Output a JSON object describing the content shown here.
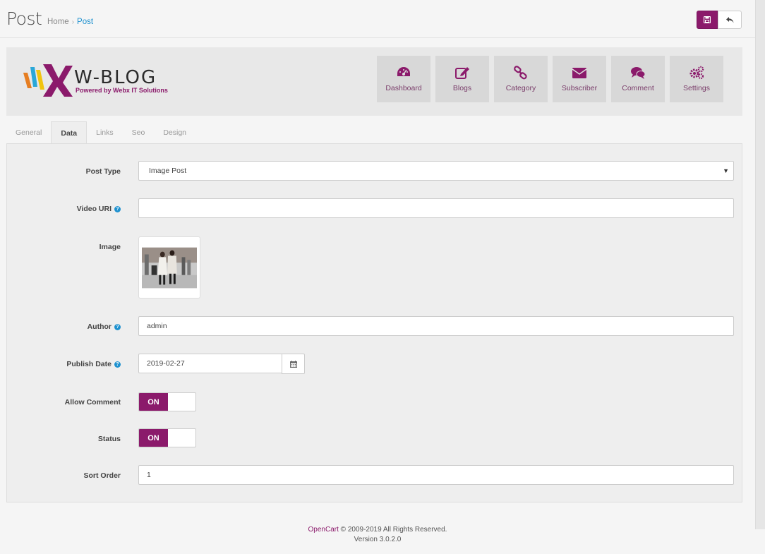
{
  "header": {
    "title": "Post",
    "breadcrumb": [
      "Home",
      "Post"
    ],
    "breadcrumb_sep": "›"
  },
  "logo": {
    "name": "W-BLOG",
    "tagline": "Powered by Webx IT Solutions"
  },
  "nav_tiles": [
    {
      "label": "Dashboard",
      "icon": "dashboard-icon"
    },
    {
      "label": "Blogs",
      "icon": "edit-icon"
    },
    {
      "label": "Category",
      "icon": "link-icon"
    },
    {
      "label": "Subscriber",
      "icon": "envelope-icon"
    },
    {
      "label": "Comment",
      "icon": "comments-icon"
    },
    {
      "label": "Settings",
      "icon": "cogs-icon"
    }
  ],
  "tabs": [
    {
      "label": "General",
      "active": false
    },
    {
      "label": "Data",
      "active": true
    },
    {
      "label": "Links",
      "active": false
    },
    {
      "label": "Seo",
      "active": false
    },
    {
      "label": "Design",
      "active": false
    }
  ],
  "form": {
    "post_type": {
      "label": "Post Type",
      "value": "Image Post"
    },
    "video_uri": {
      "label": "Video URI",
      "value": ""
    },
    "image": {
      "label": "Image"
    },
    "author": {
      "label": "Author",
      "value": "admin"
    },
    "publish_date": {
      "label": "Publish Date",
      "value": "2019-02-27"
    },
    "allow_comment": {
      "label": "Allow Comment",
      "state": "ON"
    },
    "status": {
      "label": "Status",
      "state": "ON"
    },
    "sort_order": {
      "label": "Sort Order",
      "value": "1"
    }
  },
  "footer": {
    "brand": "OpenCart",
    "copyright": "© 2009-2019 All Rights Reserved.",
    "version": "Version 3.0.2.0"
  },
  "colors": {
    "accent": "#8b1a6b",
    "help": "#1e91cf"
  }
}
